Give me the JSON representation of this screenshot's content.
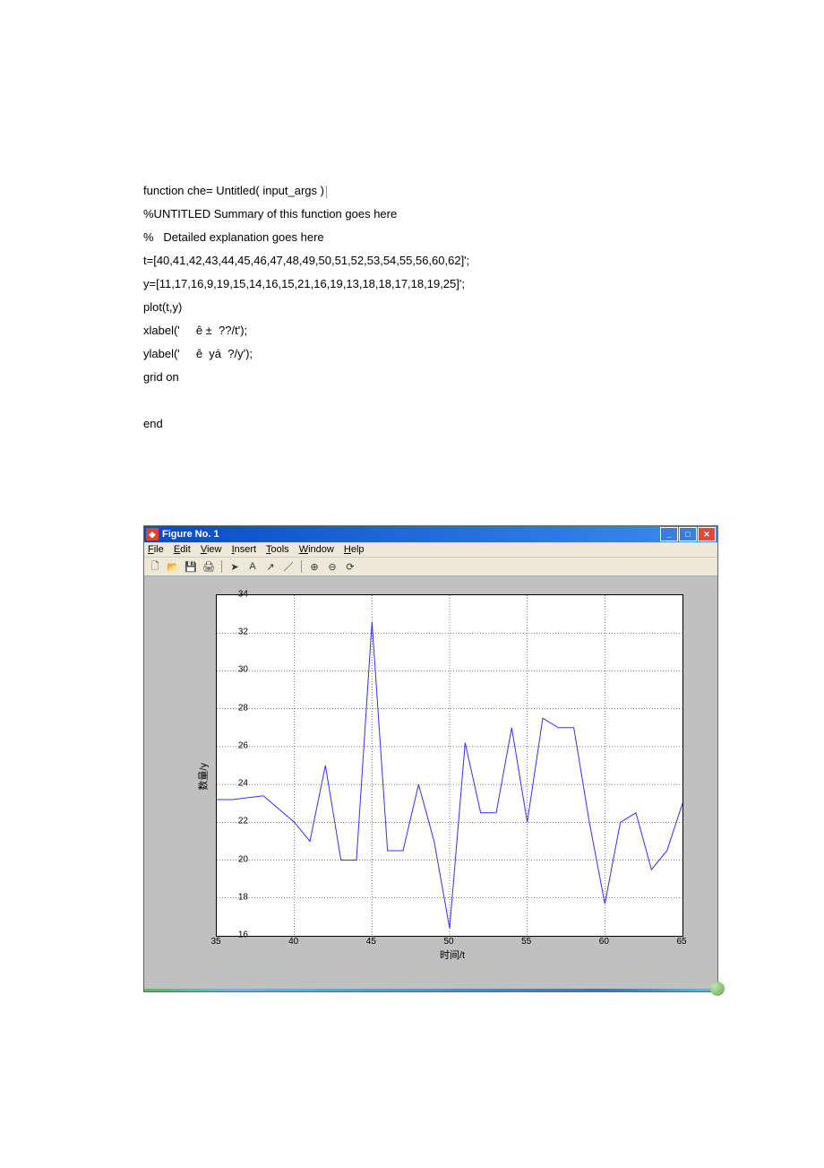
{
  "code": {
    "l1": "function che= Untitled( input_args )",
    "l2": "%UNTITLED Summary of this function goes here",
    "l3": "%   Detailed explanation goes here",
    "l4": "t=[40,41,42,43,44,45,46,47,48,49,50,51,52,53,54,55,56,60,62]';",
    "l5": "y=[11,17,16,9,19,15,14,16,15,21,16,19,13,18,18,17,18,19,25]';",
    "l6": "plot(t,y)",
    "l7": "xlabel('     ê ±  ??/t');",
    "l8": "ylabel('     ê  yá  ?/y');",
    "l9": "grid on",
    "l10": "",
    "l11": "end"
  },
  "figure": {
    "title": "Figure No. 1",
    "menu": {
      "file": "File",
      "edit": "Edit",
      "view": "View",
      "insert": "Insert",
      "tools": "Tools",
      "window": "Window",
      "help": "Help"
    }
  },
  "chart_data": {
    "type": "line",
    "xlabel": "时间/t",
    "ylabel": "数量/y",
    "xlim": [
      35,
      65
    ],
    "ylim": [
      16,
      34
    ],
    "xticks": [
      35,
      40,
      45,
      50,
      55,
      60,
      65
    ],
    "yticks": [
      16,
      18,
      20,
      22,
      24,
      26,
      28,
      30,
      32,
      34
    ],
    "x": [
      35,
      36,
      37,
      38,
      40,
      41,
      42,
      43,
      44,
      45,
      46,
      47,
      48,
      49,
      50,
      51,
      52,
      53,
      54,
      55,
      56,
      57,
      58,
      59,
      60,
      61,
      62,
      63,
      64,
      65
    ],
    "y": [
      23.2,
      23.2,
      23.3,
      23.4,
      22,
      21,
      25,
      20,
      20,
      32.6,
      20.5,
      20.5,
      24,
      21,
      16.4,
      26.2,
      22.5,
      22.5,
      27,
      22,
      27.5,
      27,
      27,
      22,
      17.7,
      22,
      22.5,
      19.5,
      20.5,
      23
    ]
  }
}
